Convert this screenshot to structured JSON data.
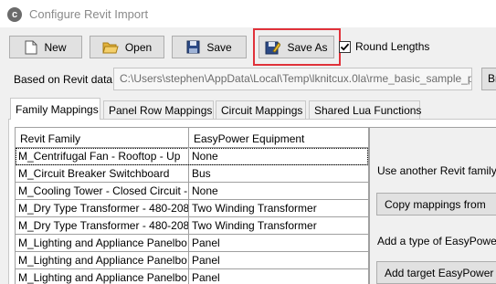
{
  "window": {
    "title": "Configure Revit Import",
    "icon": "revit-logo-icon",
    "icon_letter": "c"
  },
  "toolbar": {
    "new_label": "New",
    "open_label": "Open",
    "save_label": "Save",
    "save_as_label": "Save As",
    "round_lengths_label": "Round Lengths",
    "round_lengths_checked": true,
    "highlight_color": "#e0323a"
  },
  "source": {
    "label": "Based on Revit data:",
    "path": "C:\\Users\\stephen\\AppData\\Local\\Temp\\lknitcux.0la\\rme_basic_sample_proj",
    "browse_label": "Br"
  },
  "tabs": [
    {
      "label": "Family Mappings",
      "active": true
    },
    {
      "label": "Panel Row Mappings",
      "active": false
    },
    {
      "label": "Circuit Mappings",
      "active": false
    },
    {
      "label": "Shared Lua Functions",
      "active": false
    }
  ],
  "grid": {
    "columns": [
      "Revit Family",
      "EasyPower Equipment"
    ],
    "rows": [
      [
        "M_Centrifugal Fan -  Rooftop  - Up",
        "None"
      ],
      [
        "M_Circuit Breaker Switchboard",
        "Bus"
      ],
      [
        "M_Cooling Tower - Closed Circuit -",
        "None"
      ],
      [
        "M_Dry Type Transformer - 480-208",
        "Two Winding Transformer"
      ],
      [
        "M_Dry Type Transformer - 480-208",
        "Two Winding Transformer"
      ],
      [
        "M_Lighting and Appliance Panelbo",
        "Panel"
      ],
      [
        "M_Lighting and Appliance Panelbo",
        "Panel"
      ],
      [
        "M_Lighting and Appliance Panelbo",
        "Panel"
      ]
    ]
  },
  "side_panel": {
    "use_other_text": "Use another Revit family'",
    "copy_button": "Copy mappings from",
    "add_type_text": "Add a type of EasyPower",
    "add_target_button": "Add target EasyPower t"
  }
}
